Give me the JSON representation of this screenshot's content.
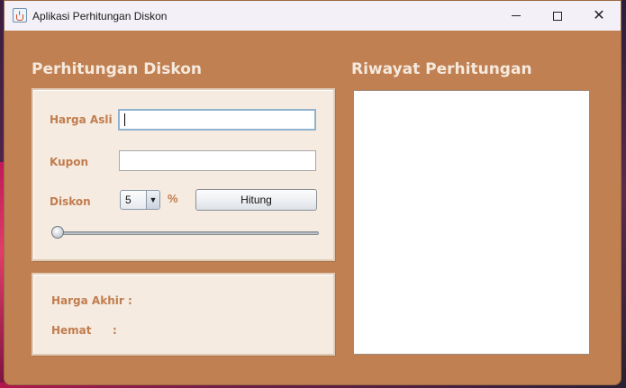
{
  "window": {
    "title": "Aplikasi Perhitungan Diskon",
    "controls": {
      "minimize": "—",
      "maximize": "☐",
      "close": "✕"
    }
  },
  "left": {
    "heading": "Perhitungan Diskon",
    "harga_asli_label": "Harga Asli",
    "harga_asli_value": "",
    "kupon_label": "Kupon",
    "kupon_value": "",
    "diskon_label": "Diskon",
    "diskon_selected": "5",
    "percent_symbol": "%",
    "hitung_label": "Hitung",
    "slider_value": 0
  },
  "result": {
    "harga_akhir_label": "Harga Akhir :",
    "hemat_label": "Hemat",
    "hemat_colon": ":"
  },
  "right": {
    "heading": "Riwayat Perhitungan",
    "history_text": ""
  },
  "colors": {
    "window_bg": "#c08051",
    "panel_bg": "#f5ebe1",
    "label": "#c17d4e",
    "heading": "#f5e9de"
  },
  "icons": {
    "app": "java-cup-icon",
    "combo_arrow": "chevron-down-icon"
  }
}
